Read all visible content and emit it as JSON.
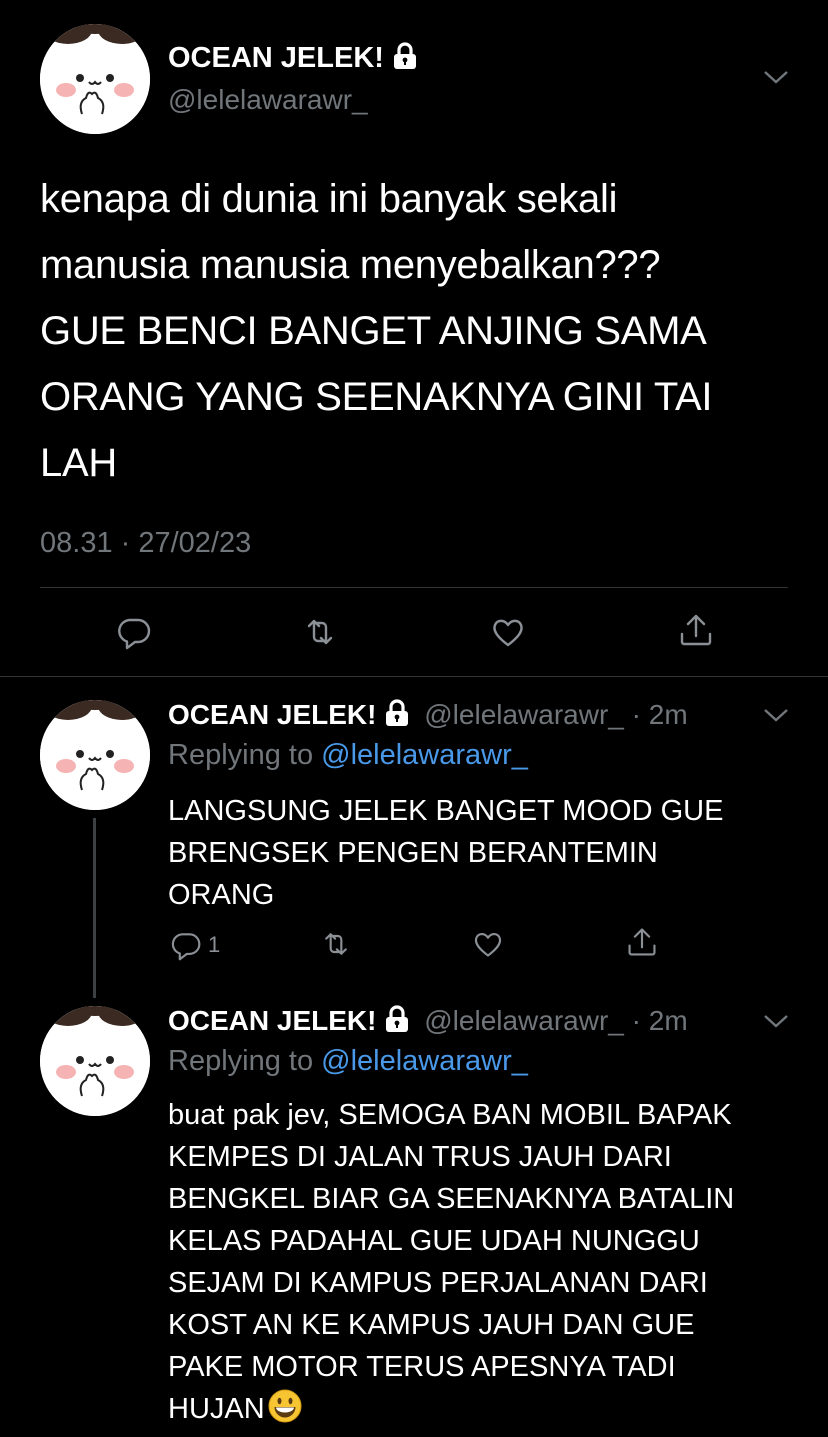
{
  "main_tweet": {
    "display_name": "OCEAN JELEK!",
    "handle": "@lelelawarawr_",
    "text_lines": [
      "kenapa di dunia ini banyak sekali",
      "manusia manusia menyebalkan???",
      "GUE BENCI BANGET ANJING SAMA",
      "ORANG YANG SEENAKNYA GINI TAI",
      "LAH"
    ],
    "timestamp": "08.31 · 27/02/23"
  },
  "replies": [
    {
      "display_name": "OCEAN JELEK!",
      "handle_time": "@lelelawarawr_ · 2m",
      "replying_prefix": "Replying to ",
      "replying_to": "@lelelawarawr_",
      "text_lines": [
        "LANGSUNG JELEK BANGET MOOD GUE",
        "BRENGSEK PENGEN BERANTEMIN",
        "ORANG"
      ],
      "reply_count": "1"
    },
    {
      "display_name": "OCEAN JELEK!",
      "handle_time": "@lelelawarawr_ · 2m",
      "replying_prefix": "Replying to ",
      "replying_to": "@lelelawarawr_",
      "text_lines": [
        "buat pak jev, SEMOGA BAN MOBIL BAPAK",
        "KEMPES DI JALAN TRUS JAUH DARI",
        "BENGKEL BIAR GA SEENAKNYA BATALIN",
        "KELAS PADAHAL GUE UDAH NUNGGU",
        "SEJAM DI KAMPUS PERJALANAN DARI",
        "KOST AN KE KAMPUS JAUH DAN GUE",
        "PAKE MOTOR TERUS APESNYA TADI",
        "HUJAN"
      ]
    }
  ],
  "icons": {
    "lock": "lock-icon",
    "chevron": "chevron-down-icon",
    "reply": "reply-icon",
    "retweet": "retweet-icon",
    "like": "heart-icon",
    "share": "share-icon",
    "emoji": "grinning-emoji-icon"
  },
  "colors": {
    "background": "#000000",
    "text": "#e7e9ea",
    "muted": "#71767b",
    "link": "#4a99e9",
    "divider": "#2f3336"
  }
}
